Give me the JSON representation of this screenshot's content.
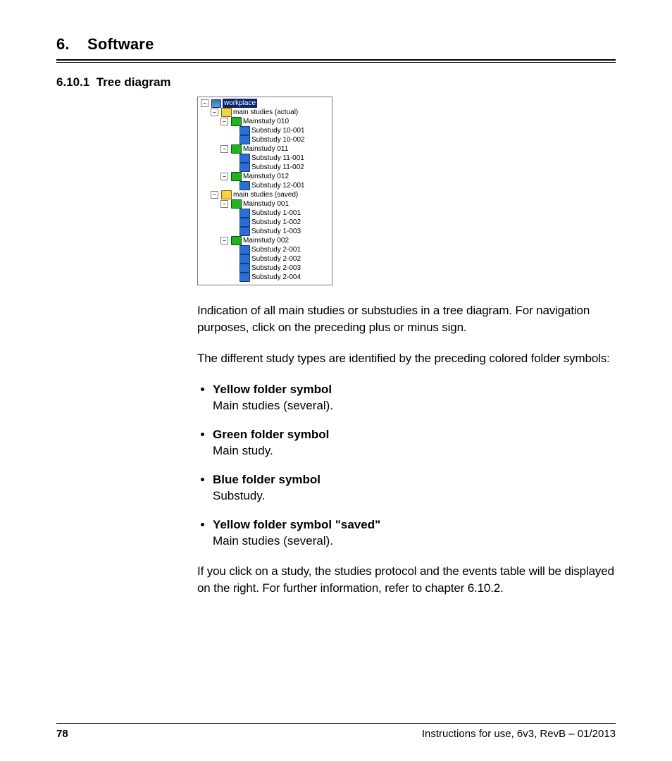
{
  "chapter": {
    "number": "6.",
    "title": "Software"
  },
  "section": {
    "number": "6.10.1",
    "title": "Tree diagram"
  },
  "tree": {
    "root": "workplace",
    "groups": [
      {
        "label": "main studies (actual)",
        "color": "yellow",
        "children": [
          {
            "label": "Mainstudy 010",
            "color": "green",
            "children": [
              {
                "label": "Substudy 10-001",
                "color": "blue"
              },
              {
                "label": "Substudy 10-002",
                "color": "blue"
              }
            ]
          },
          {
            "label": "Mainstudy 011",
            "color": "green",
            "children": [
              {
                "label": "Substudy 11-001",
                "color": "blue"
              },
              {
                "label": "Substudy 11-002",
                "color": "blue"
              }
            ]
          },
          {
            "label": "Mainstudy 012",
            "color": "green",
            "children": [
              {
                "label": "Substudy 12-001",
                "color": "blue"
              }
            ]
          }
        ]
      },
      {
        "label": "main studies (saved)",
        "color": "yellow",
        "children": [
          {
            "label": "Mainstudy 001",
            "color": "green",
            "children": [
              {
                "label": "Substudy 1-001",
                "color": "blue"
              },
              {
                "label": "Substudy 1-002",
                "color": "blue"
              },
              {
                "label": "Substudy 1-003",
                "color": "blue"
              }
            ]
          },
          {
            "label": "Mainstudy 002",
            "color": "green",
            "children": [
              {
                "label": "Substudy 2-001",
                "color": "blue"
              },
              {
                "label": "Substudy 2-002",
                "color": "blue"
              },
              {
                "label": "Substudy 2-003",
                "color": "blue"
              },
              {
                "label": "Substudy 2-004",
                "color": "blue"
              }
            ]
          }
        ]
      }
    ]
  },
  "paragraphs": {
    "p1": "Indication of all main studies or substudies in a tree diagram. For navigation purposes, click on the preceding plus or minus sign.",
    "p2": "The different study types are identified by the preceding colored folder symbols:",
    "p3": "If you click on a study, the studies protocol and the events table will be displayed on the right. For further information, refer to chapter 6.10.2."
  },
  "bullets": [
    {
      "lead": "Yellow folder symbol",
      "desc": "Main studies (several)."
    },
    {
      "lead": "Green folder symbol",
      "desc": "Main study."
    },
    {
      "lead": "Blue folder symbol",
      "desc": "Substudy."
    },
    {
      "lead": "Yellow folder symbol \"saved\"",
      "desc": "Main studies (several)."
    }
  ],
  "footer": {
    "page": "78",
    "doc": "Instructions for use, 6v3, RevB – 01/2013"
  }
}
